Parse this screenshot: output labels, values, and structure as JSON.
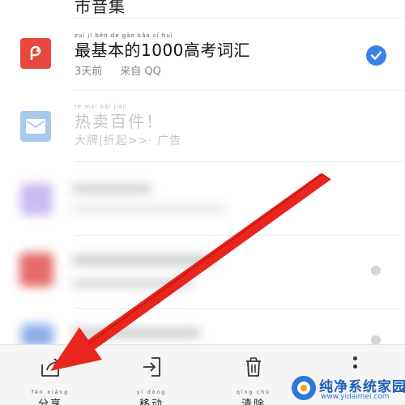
{
  "list": {
    "top_partial_title": "市音集",
    "items": [
      {
        "app": "WPS",
        "ruby": "zuì  jī  běn  de          gāo  kǎo  cí  huì",
        "title": "最基本的1000高考词汇",
        "meta_time": "3天前",
        "meta_source": "来自 QQ",
        "selected": true
      },
      {
        "app": "Mail",
        "ruby": "rè  mài  bǎi  jiàn",
        "title": "热卖百件！",
        "subtitle": "大牌|折起>>· 广告",
        "selected": false
      }
    ]
  },
  "toolbar": {
    "share": {
      "pinyin": "fēn  xiǎng",
      "label": "分享"
    },
    "move": {
      "pinyin": "yí  dòng",
      "label": "移动"
    },
    "clear": {
      "pinyin": "qīng  chú",
      "label": "清除"
    }
  },
  "watermark": {
    "title": "纯净系统家园",
    "url": "www.yidaimei.com"
  },
  "colors": {
    "wps_red": "#e8483f",
    "check_blue": "#3b82e8",
    "arrow_red": "#e8251f",
    "mail_blue": "#a9c9ef"
  }
}
